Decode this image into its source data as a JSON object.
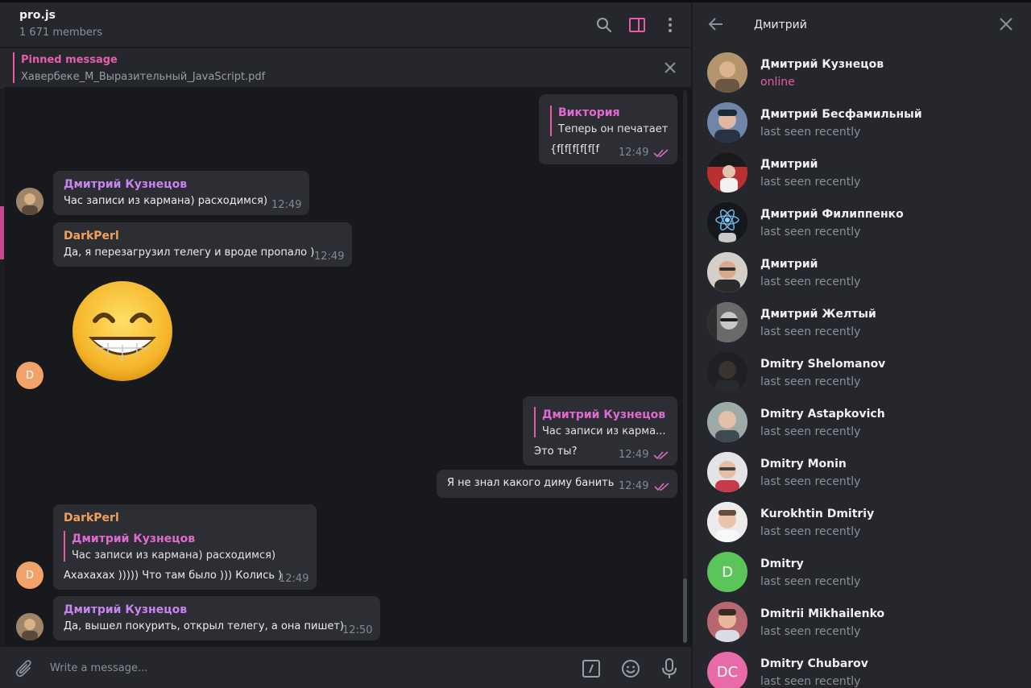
{
  "chat": {
    "title": "pro.js",
    "members": "1 671 members",
    "pinned": {
      "title": "Pinned message",
      "text": "Хавербеке_М_Выразительный_JavaScript.pdf"
    },
    "composer_placeholder": "Write a message..."
  },
  "messages": [
    {
      "quote_name": "Виктория",
      "quote_text": "Теперь он печатает",
      "text": "{f[f[f[f[f[f",
      "time": "12:49"
    },
    {
      "name": "Дмитрий Кузнецов",
      "text": "Час записи из кармана) расходимся)",
      "time": "12:49"
    },
    {
      "name": "DarkPerl",
      "text": "Да, я перезагрузил телегу и вроде пропало )",
      "time": "12:49"
    },
    {
      "sticker": "😁",
      "avatar_initial": "D"
    },
    {
      "quote_name": "Дмитрий Кузнецов",
      "quote_text": "Час записи из карма...",
      "text": "Это ты?",
      "time": "12:49"
    },
    {
      "text": "Я не знал какого диму банить",
      "time": "12:49"
    },
    {
      "name": "DarkPerl",
      "quote_name": "Дмитрий Кузнецов",
      "quote_text": "Час записи из кармана) расходимся)",
      "text": "Ахахахах ))))) Что там было ))) Колись )",
      "time": "12:49",
      "avatar_initial": "D"
    },
    {
      "name": "Дмитрий Кузнецов",
      "text": "Да, вышел покурить, открыл телегу, а она пишет)",
      "time": "12:50"
    }
  ],
  "panel": {
    "query": "Дмитрий",
    "members": [
      {
        "name": "Дмитрий Кузнецов",
        "status": "online"
      },
      {
        "name": "Дмитрий Бесфамильный",
        "status": "last seen recently"
      },
      {
        "name": "Дмитрий",
        "status": "last seen recently"
      },
      {
        "name": "Дмитрий Филиппенко",
        "status": "last seen recently"
      },
      {
        "name": "Дмитрий",
        "status": "last seen recently"
      },
      {
        "name": "Дмитрий Желтый",
        "status": "last seen recently"
      },
      {
        "name": "Dmitry Shelomanov",
        "status": "last seen recently"
      },
      {
        "name": "Dmitry Astapkovich",
        "status": "last seen recently"
      },
      {
        "name": "Dmitry Monin",
        "status": "last seen recently"
      },
      {
        "name": "Kurokhtin Dmitriy",
        "status": "last seen recently"
      },
      {
        "name": "Dmitry",
        "status": "last seen recently",
        "initials": "D"
      },
      {
        "name": "Dmitrii Mikhailenko",
        "status": "last seen recently"
      },
      {
        "name": "Dmitry Chubarov",
        "status": "last seen recently",
        "initials": "DC"
      }
    ]
  },
  "colors": {
    "accent": "#e75aa6",
    "name_purple": "#c884f0",
    "name_orange": "#f2a15a",
    "avatar_green": "#5cc55a",
    "avatar_pink": "#e86aa8",
    "avatar_orange": "#f0a26a"
  },
  "icons": [
    "search-icon",
    "sidebar-toggle-icon",
    "more-vertical-icon",
    "close-icon",
    "back-arrow-icon",
    "attach-icon",
    "bot-command-icon",
    "emoji-icon",
    "microphone-icon",
    "double-check-icon"
  ]
}
